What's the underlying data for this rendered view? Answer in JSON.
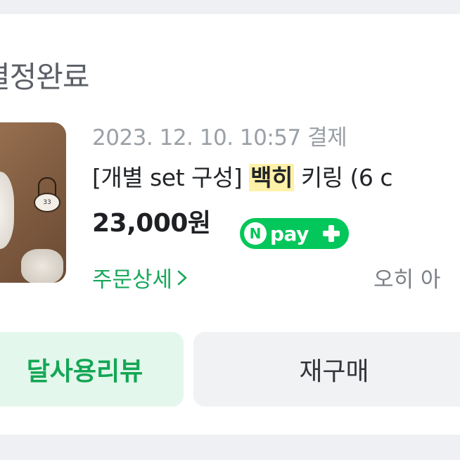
{
  "order": {
    "status": "결정완료",
    "date": "2023. 12. 10. 10:57 결제",
    "title_before": "[개별 set 구성] ",
    "title_highlight": "백히",
    "title_after": " 키링 (6 c",
    "price": "23,000원",
    "npay": {
      "n": "N",
      "pay": "pay"
    },
    "detail_link": "주문상세",
    "seller": "오히 아"
  },
  "actions": {
    "review_label": "달사용리뷰",
    "rebuy_label": "재구매"
  },
  "colors": {
    "green": "#03c75a",
    "link_green": "#17a85b",
    "highlight": "#fff2a8"
  }
}
